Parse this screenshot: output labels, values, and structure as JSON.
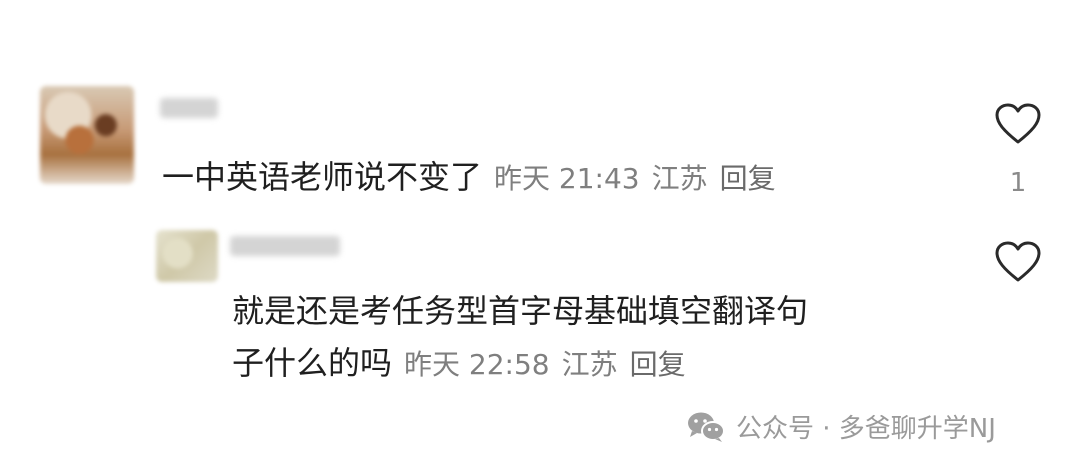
{
  "comments": [
    {
      "text": "一中英语老师说不变了",
      "time": "昨天 21:43",
      "location": "江苏",
      "reply_label": "回复",
      "likes": "1"
    }
  ],
  "reply": {
    "text_line1": "就是还是考任务型首字母基础填空翻译句",
    "text_line2": "子什么的吗",
    "time": "昨天 22:58",
    "location": "江苏",
    "reply_label": "回复"
  },
  "watermark": {
    "text": "公众号 · 多爸聊升学NJ",
    "icon": "wechat-icon"
  },
  "icons": {
    "like": "heart-outline-icon"
  }
}
